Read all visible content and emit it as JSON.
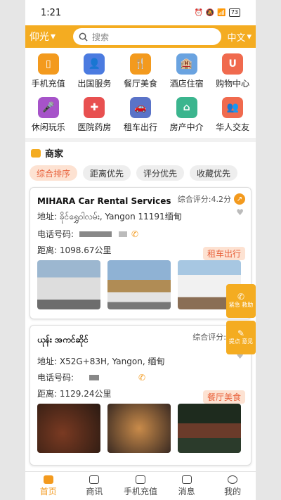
{
  "status": {
    "time": "1:21",
    "battery": "73"
  },
  "header": {
    "city": "仰光",
    "search_placeholder": "搜索",
    "language": "中文"
  },
  "categories": [
    {
      "label": "手机充值",
      "icon": "phone-recharge-icon",
      "color": "#f39a1e"
    },
    {
      "label": "出国服务",
      "icon": "person-icon",
      "color": "#4b7be0"
    },
    {
      "label": "餐厅美食",
      "icon": "fork-spoon-icon",
      "color": "#f39a1e"
    },
    {
      "label": "酒店住宿",
      "icon": "hotel-icon",
      "color": "#6aa3e0"
    },
    {
      "label": "购物中心",
      "icon": "shopping-bag-icon",
      "color": "#f06a4e"
    },
    {
      "label": "休闲玩乐",
      "icon": "microphone-icon",
      "color": "#a653c9"
    },
    {
      "label": "医院药房",
      "icon": "hospital-icon",
      "color": "#e85050"
    },
    {
      "label": "租车出行",
      "icon": "car-icon",
      "color": "#5a73c8"
    },
    {
      "label": "房产中介",
      "icon": "house-icon",
      "color": "#3bb58e"
    },
    {
      "label": "华人交友",
      "icon": "people-icon",
      "color": "#f06a4e"
    }
  ],
  "merchants": {
    "title": "商家",
    "sorts": [
      "综合排序",
      "距离优先",
      "评分优先",
      "收藏优先"
    ],
    "list": [
      {
        "name": "MIHARA Car Rental Services",
        "rating": "综合评分:4.2分",
        "address": "地址:  ခိုင်ရွှေဝါလမ်း, Yangon 11191缅甸",
        "phone_label": "电话号码:",
        "distance": "距离:  1098.67公里",
        "tag": "租车出行"
      },
      {
        "name": "ယုန်း အကင်ဆိုင်",
        "rating": "综合评分:3",
        "address": "地址:  X52G+83H, Yangon, 缅甸",
        "phone_label": "电话号码:",
        "distance": "距离:  1129.24公里",
        "tag": "餐厅美食"
      }
    ]
  },
  "float_buttons": [
    {
      "label": "紧急 救助"
    },
    {
      "label": "提点 意见"
    }
  ],
  "tabs": [
    {
      "label": "首页",
      "active": true
    },
    {
      "label": "商讯",
      "active": false
    },
    {
      "label": "手机充值",
      "active": false
    },
    {
      "label": "消息",
      "active": false
    },
    {
      "label": "我的",
      "active": false
    }
  ],
  "colors": {
    "accent": "#f4ac21",
    "tag_text": "#e8603a",
    "tag_bg": "#fde2d2"
  }
}
